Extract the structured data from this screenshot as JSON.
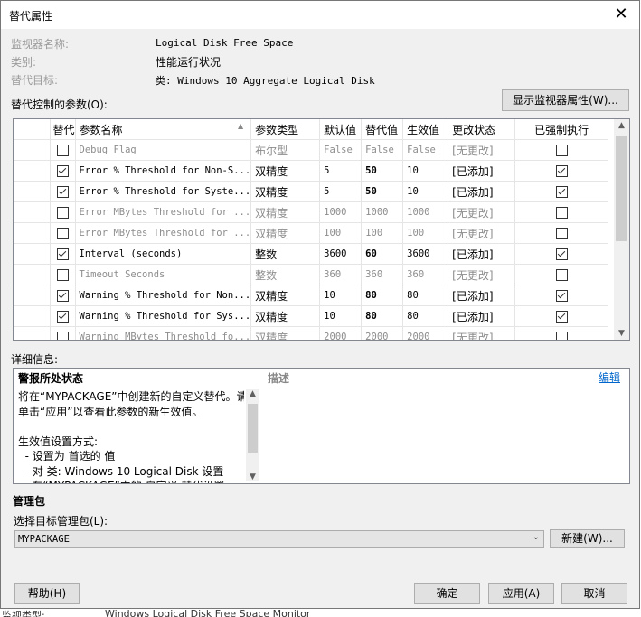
{
  "window": {
    "title": "替代属性"
  },
  "info": {
    "monitor_name_label": "监视器名称:",
    "monitor_name": "Logical Disk Free Space",
    "category_label": "类别:",
    "category": "性能运行状况",
    "target_label": "替代目标:",
    "target": "类: Windows 10 Aggregate Logical Disk"
  },
  "params": {
    "heading": "替代控制的参数(O):",
    "show_props_button": "显示监视器属性(W)...",
    "columns": [
      "替代",
      "参数名称",
      "参数类型",
      "默认值",
      "替代值",
      "生效值",
      "更改状态",
      "已强制执行"
    ],
    "rows": [
      {
        "override": false,
        "name": "Debug Flag",
        "type": "布尔型",
        "default": "False",
        "value": "False",
        "effective": "False",
        "status": "[无更改]",
        "enforced": false
      },
      {
        "override": true,
        "name": "Error % Threshold for Non-S...",
        "type": "双精度",
        "default": "5",
        "value": "50",
        "effective": "10",
        "status": "[已添加]",
        "enforced": true
      },
      {
        "override": true,
        "name": "Error % Threshold for Syste...",
        "type": "双精度",
        "default": "5",
        "value": "50",
        "effective": "10",
        "status": "[已添加]",
        "enforced": true
      },
      {
        "override": false,
        "name": "Error MBytes Threshold for ...",
        "type": "双精度",
        "default": "1000",
        "value": "1000",
        "effective": "1000",
        "status": "[无更改]",
        "enforced": false
      },
      {
        "override": false,
        "name": "Error MBytes Threshold for ...",
        "type": "双精度",
        "default": "100",
        "value": "100",
        "effective": "100",
        "status": "[无更改]",
        "enforced": false
      },
      {
        "override": true,
        "name": "Interval (seconds)",
        "type": "整数",
        "default": "3600",
        "value": "60",
        "effective": "3600",
        "status": "[已添加]",
        "enforced": true
      },
      {
        "override": false,
        "name": "Timeout Seconds",
        "type": "整数",
        "default": "360",
        "value": "360",
        "effective": "360",
        "status": "[无更改]",
        "enforced": false
      },
      {
        "override": true,
        "name": "Warning % Threshold for Non...",
        "type": "双精度",
        "default": "10",
        "value": "80",
        "effective": "80",
        "status": "[已添加]",
        "enforced": true
      },
      {
        "override": true,
        "name": "Warning % Threshold for Sys...",
        "type": "双精度",
        "default": "10",
        "value": "80",
        "effective": "80",
        "status": "[已添加]",
        "enforced": true
      },
      {
        "override": false,
        "name": "Warning MBytes Threshold fo...",
        "type": "双精度",
        "default": "2000",
        "value": "2000",
        "effective": "2000",
        "status": "[无更改]",
        "enforced": false
      }
    ]
  },
  "details": {
    "heading": "详细信息:",
    "alert_state": "警报所处状态",
    "description_label": "描述",
    "edit_link": "编辑",
    "text": "将在“MYPACKAGE”中创建新的自定义替代。请\n单击“应用”以查看此参数的新生效值。\n\n生效值设置方式:\n  - 设置为 首选的 值\n  - 对 类: Windows 10 Logical Disk 设置\n    在“MYPACKAGE”中的 自定义 替代设置"
  },
  "management_pack": {
    "heading": "管理包",
    "select_label": "选择目标管理包(L):",
    "selected": "MYPACKAGE",
    "new_button": "新建(W)..."
  },
  "footer": {
    "help": "帮助(H)",
    "ok": "确定",
    "apply": "应用(A)",
    "cancel": "取消"
  },
  "background": {
    "partial_label": "监视类型:",
    "partial_text": "Windows Logical Disk Free Space Monitor"
  }
}
